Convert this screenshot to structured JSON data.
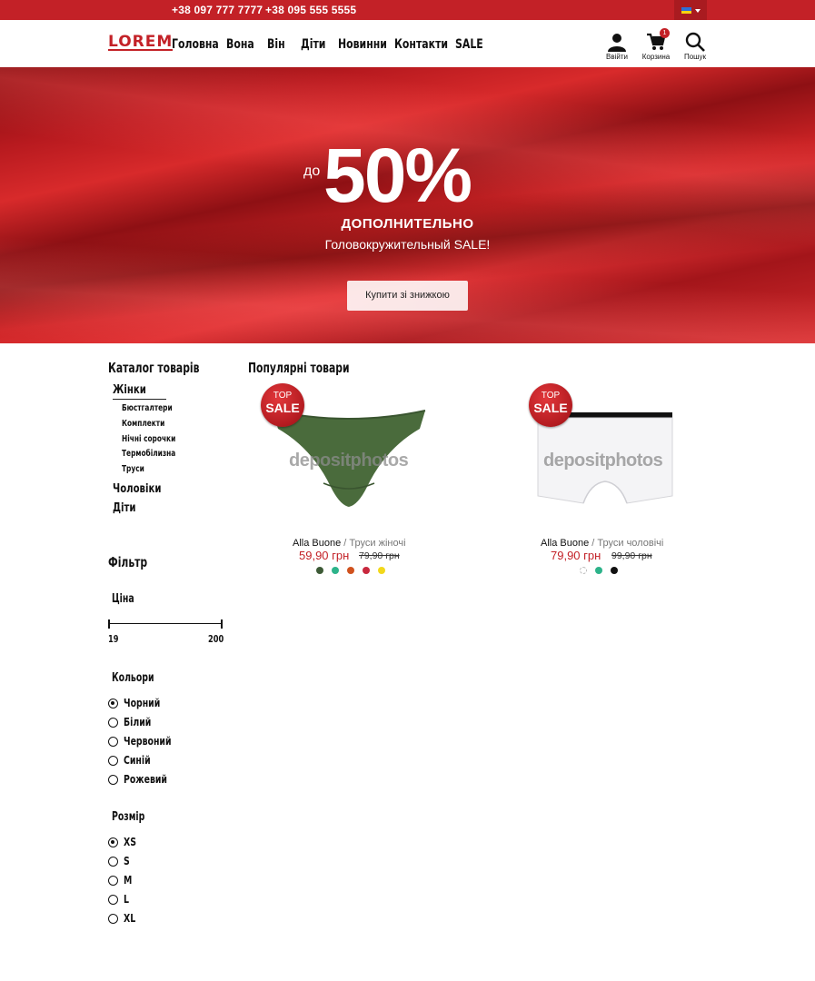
{
  "topbar": {
    "phones": [
      "+38 097 777 7777",
      "+38 095 555 5555"
    ],
    "language_flag": "ukraine-flag"
  },
  "header": {
    "logo": "LOREM",
    "nav": [
      "Головна",
      "Вона",
      "Він",
      "Діти",
      "Новинни",
      "Контакти",
      "SALE"
    ],
    "login_label": "Ввійти",
    "cart_label": "Корзина",
    "cart_count": "1",
    "search_label": "Пошук"
  },
  "hero": {
    "prefix": "до",
    "big": "50%",
    "line1": "ДОПОЛНИТЕЛЬНО",
    "line2": "Головокружительный SALE!",
    "button": "Купити зі знижкою"
  },
  "sidebar": {
    "catalog_title": "Каталог товарів",
    "categories": [
      {
        "label": "Жінки",
        "children": [
          "Бюстгалтери",
          "Комплекти",
          "Нічні сорочки",
          "Термобілизна",
          "Труси"
        ]
      },
      {
        "label": "Чоловіки",
        "children": []
      },
      {
        "label": "Діти",
        "children": []
      }
    ],
    "filter_title": "Фільтр",
    "price_title": "Ціна",
    "price_min": "19",
    "price_max": "200",
    "colors_title": "Кольори",
    "colors": [
      "Чорний",
      "Білий",
      "Червоний",
      "Синій",
      "Рожевий"
    ],
    "colors_selected": "Чорний",
    "size_title": "Розмір",
    "sizes": [
      "XS",
      "S",
      "M",
      "L",
      "XL"
    ],
    "size_selected": "XS"
  },
  "products": {
    "title": "Популярні товари",
    "badge_top": "TOP",
    "badge_bottom": "SALE",
    "watermark": "depositphotos",
    "items": [
      {
        "brand": "Alla Buone",
        "sep": "/",
        "name": "Труси жіночі",
        "price": "59,90 грн",
        "old_price": "79,90 грн",
        "swatches": [
          "#3d5a36",
          "#2db38a",
          "#d0521e",
          "#c8283e",
          "#f2d81b"
        ]
      },
      {
        "brand": "Alla Buone",
        "sep": "/",
        "name": "Труси чоловічі",
        "price": "79,90 грн",
        "old_price": "99,90 грн",
        "swatches": [
          "#ffffff",
          "#2db38a",
          "#111111"
        ]
      }
    ]
  },
  "colors": {
    "brand_red": "#c32127",
    "price_red": "#c32127"
  }
}
